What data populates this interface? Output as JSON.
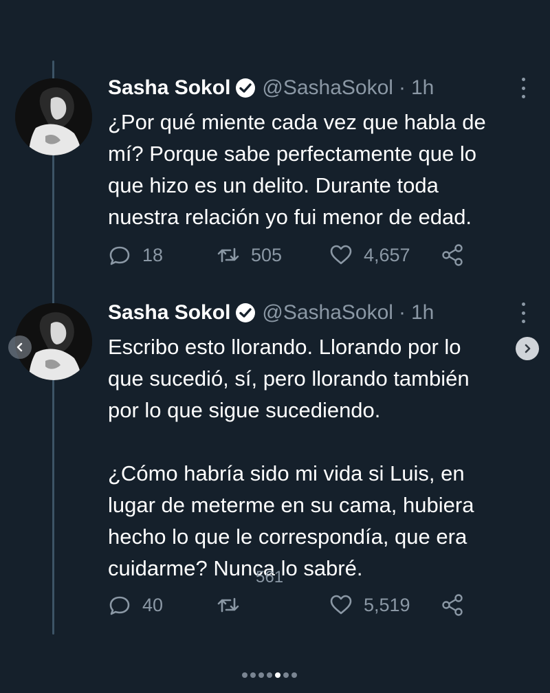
{
  "tweets": [
    {
      "name": "Sasha Sokol",
      "handle": "@SashaSokol",
      "separator": "·",
      "time": "1h",
      "text": "¿Por qué miente cada vez que habla de\nmí? Porque sabe perfectamente que lo\nque hizo es un delito. Durante toda\nnuestra relación yo fui menor de edad.",
      "replies": "18",
      "retweets": "505",
      "likes": "4,657"
    },
    {
      "name": "Sasha Sokol",
      "handle": "@SashaSokol",
      "separator": "·",
      "time": "1h",
      "text": "Escribo esto llorando. Llorando por lo\nque sucedió, sí, pero llorando también\npor lo que sigue sucediendo.\n\n¿Cómo habría sido mi vida si Luis, en\nlugar de meterme en su cama, hubiera\nhecho lo que le correspondía, que era\ncuidarme? Nunca lo sabré.",
      "replies": "40",
      "retweets": "561",
      "likes": "5,519"
    }
  ],
  "carousel": {
    "total_dots": 7,
    "active_dot": 4
  },
  "icons": {
    "verified": "verified-badge-icon",
    "more": "more-options-icon",
    "reply": "reply-icon",
    "retweet": "retweet-icon",
    "like": "heart-icon",
    "share": "share-icon",
    "prev": "chevron-left-icon",
    "next": "chevron-right-icon"
  },
  "colors": {
    "background": "#15202b",
    "text_primary": "#ffffff",
    "text_secondary": "#8b98a5",
    "thread_line": "#3d5466"
  }
}
